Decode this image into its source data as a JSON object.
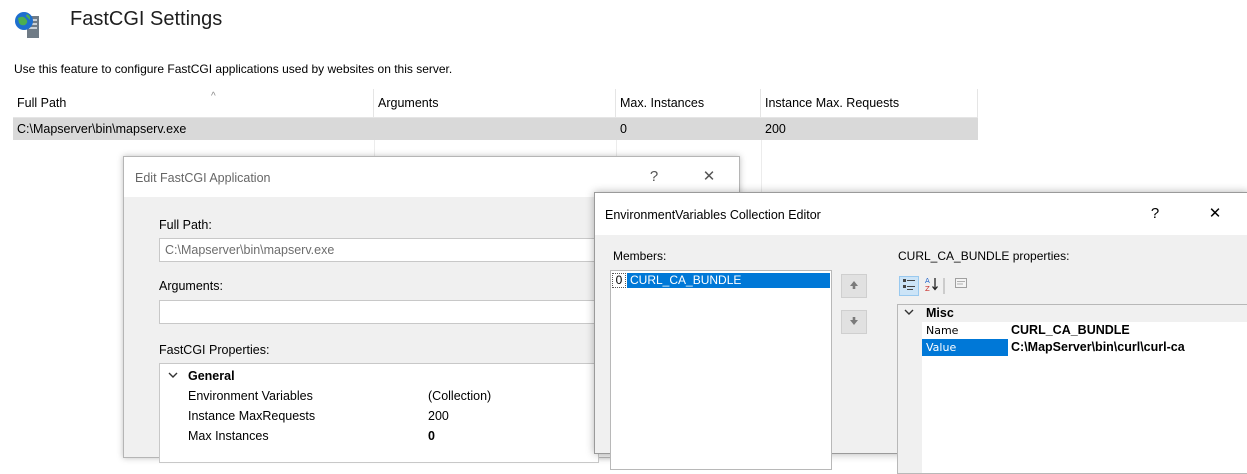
{
  "page": {
    "title": "FastCGI Settings",
    "description": "Use this feature to configure FastCGI applications used by websites on this server.",
    "icon": "server-globe-icon"
  },
  "list": {
    "columns": [
      "Full Path",
      "Arguments",
      "Max. Instances",
      "Instance Max. Requests"
    ],
    "sort_indicator": "^",
    "rows": [
      {
        "full_path": "C:\\Mapserver\\bin\\mapserv.exe",
        "arguments": "",
        "max_instances": "0",
        "instance_max_requests": "200"
      }
    ],
    "selected_row_color": "#d9d9d9"
  },
  "edit_dialog": {
    "title": "Edit FastCGI Application",
    "help_label": "?",
    "close_label": "✕",
    "full_path_label": "Full Path:",
    "full_path_value": "C:\\Mapserver\\bin\\mapserv.exe",
    "arguments_label": "Arguments:",
    "arguments_value": "",
    "properties_label": "FastCGI Properties:",
    "category": "General",
    "properties": [
      {
        "name": "Environment Variables",
        "value": "(Collection)"
      },
      {
        "name": "Instance MaxRequests",
        "value": "200"
      },
      {
        "name": "Max Instances",
        "value": "0"
      }
    ]
  },
  "collection_editor": {
    "title": "EnvironmentVariables Collection Editor",
    "help_label": "?",
    "close_label": "✕",
    "members_label": "Members:",
    "members": [
      {
        "index": "0",
        "name": "CURL_CA_BUNDLE"
      }
    ],
    "move_up_icon": "arrow-up-icon",
    "move_down_icon": "arrow-down-icon",
    "properties_label": "CURL_CA_BUNDLE properties:",
    "toolbar": {
      "categorized_icon": "categorized-icon",
      "alphabetical_icon": "sort-alphabetical-icon",
      "property_pages_icon": "property-pages-icon"
    },
    "category": "Misc",
    "properties": [
      {
        "name": "Name",
        "value": "CURL_CA_BUNDLE"
      },
      {
        "name": "Value",
        "value": "C:\\MapServer\\bin\\curl\\curl-ca"
      }
    ],
    "accent_color": "#0078d7"
  }
}
